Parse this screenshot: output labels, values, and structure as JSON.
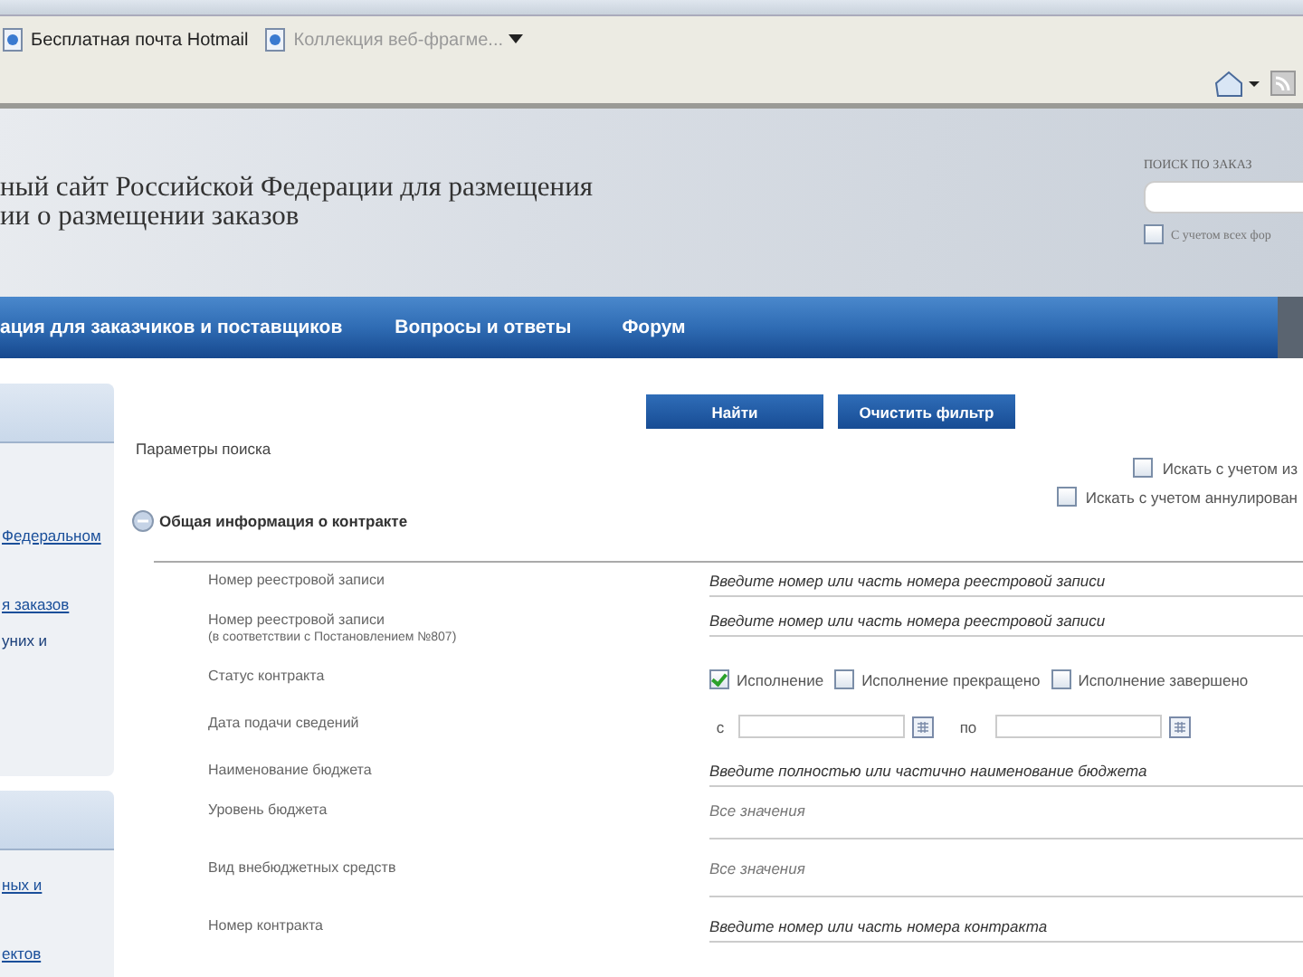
{
  "browser": {
    "favorites": [
      {
        "label": "Бесплатная почта Hotmail",
        "kind": "link"
      },
      {
        "label": "Коллекция веб-фрагме...",
        "kind": "menu"
      }
    ]
  },
  "header": {
    "title_lines": [
      "ный сайт Российской Федерации для размещения",
      "ии о размещении заказов"
    ],
    "search": {
      "label": "ПОИСК ПО ЗАКАЗ"
    },
    "search_option": {
      "label": "С учетом всех фор",
      "checked": false
    }
  },
  "nav": [
    {
      "label": "ация для заказчиков и поставщиков"
    },
    {
      "label": "Вопросы и ответы"
    },
    {
      "label": "Форум"
    }
  ],
  "sidebar": [
    {
      "links": [
        {
          "label": "Федеральном",
          "kind": "link"
        },
        {
          "label": "я заказов",
          "kind": "link"
        },
        {
          "label": "уних и",
          "kind": "text"
        }
      ]
    },
    {
      "links": [
        {
          "label": "ных и",
          "kind": "link"
        },
        {
          "label": "ектов",
          "kind": "link"
        }
      ]
    }
  ],
  "buttons": [
    "Найти",
    "Очистить фильтр"
  ],
  "search_params": {
    "title": "Параметры поиска",
    "options": [
      {
        "label": "Искать с учетом из",
        "checked": false
      },
      {
        "label": "Искать с учетом аннулирован",
        "checked": false
      }
    ]
  },
  "section": {
    "title": "Общая информация о контракте",
    "expanded": true
  },
  "fields": [
    {
      "label": "Номер реестровой записи",
      "kind": "text",
      "placeholder": "Введите номер или часть номера реестровой записи"
    },
    {
      "label": "Номер реестровой записи",
      "note": "(в соответствии с Постановлением №807)",
      "kind": "text",
      "placeholder": "Введите номер или часть номера реестровой записи"
    },
    {
      "label": "Статус контракта",
      "kind": "checks",
      "options": [
        {
          "label": "Исполнение",
          "checked": true
        },
        {
          "label": "Исполнение прекращено",
          "checked": false
        },
        {
          "label": "Исполнение завершено",
          "checked": false
        }
      ]
    },
    {
      "label": "Дата подачи сведений",
      "kind": "date",
      "from_label": "с",
      "to_label": "по"
    },
    {
      "label": "Наименование бюджета",
      "kind": "text",
      "placeholder": "Введите полностью или частично наименование бюджета"
    },
    {
      "label": "Уровень бюджета",
      "kind": "select",
      "value": "Все значения"
    },
    {
      "label": "Вид внебюджетных средств",
      "kind": "select",
      "value": "Все значения"
    },
    {
      "label": "Номер контракта",
      "kind": "text",
      "placeholder": "Введите номер или часть номера контракта"
    }
  ]
}
